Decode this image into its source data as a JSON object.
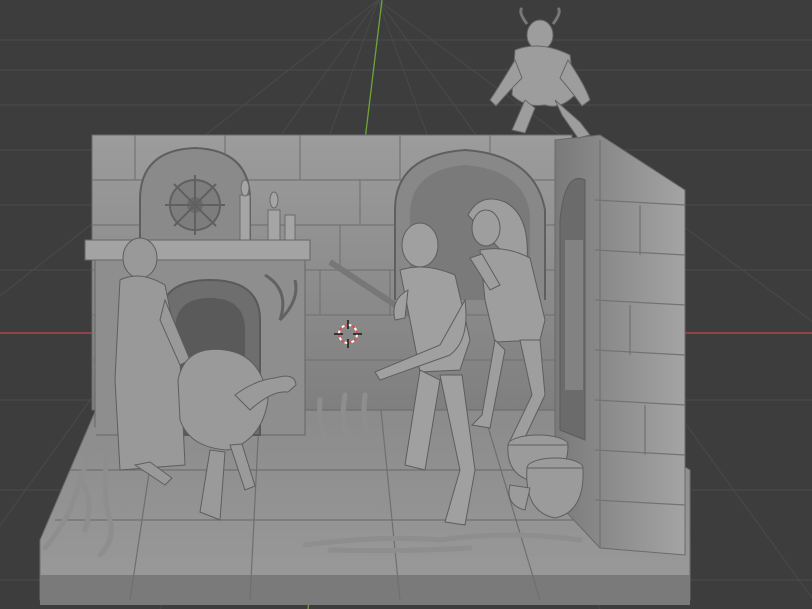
{
  "viewport": {
    "background": "#3d3d3d",
    "grid_color": "#4a4a4a",
    "x_axis_color": "#c24a4f",
    "y_axis_color": "#6fa33a",
    "model_color": "#8f8f8f",
    "model_light": "#a9a9a9",
    "model_dark": "#5e5e5e"
  },
  "objects": [
    "diorama-base",
    "stone-wall-back",
    "stone-wall-side",
    "gothic-window-left",
    "gothic-window-right",
    "fireplace",
    "candles",
    "old-woman-figure",
    "creature-figure",
    "man-with-sword-figure",
    "woman-figure",
    "demon-figure",
    "pots",
    "roots"
  ],
  "gizmo": "3d-cursor"
}
